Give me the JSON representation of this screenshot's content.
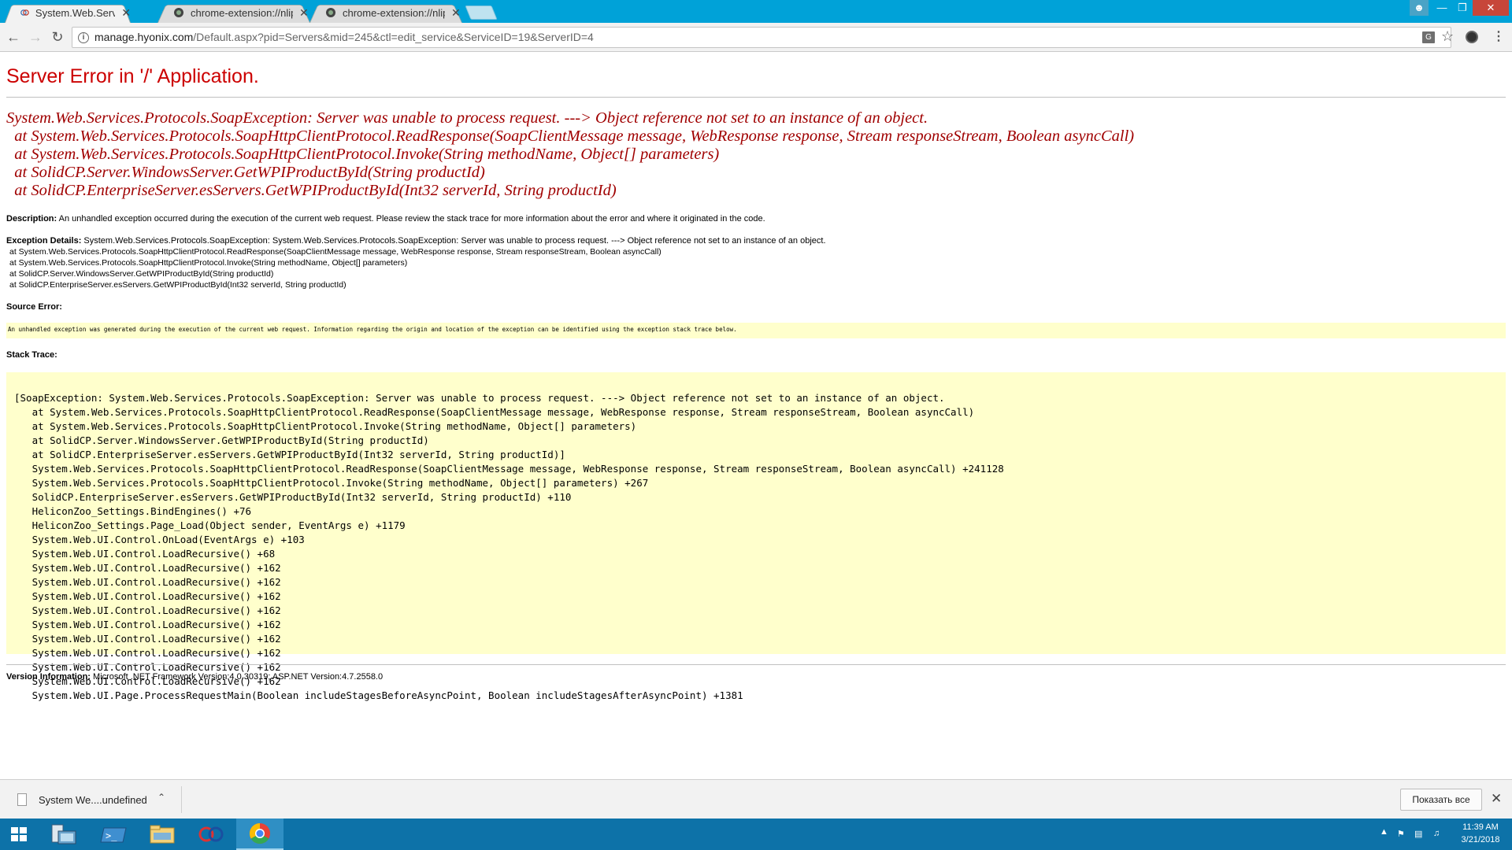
{
  "browser": {
    "tabs": [
      {
        "title": "System.Web.Services.Pro",
        "active": true
      },
      {
        "title": "chrome-extension://nlip",
        "active": false
      },
      {
        "title": "chrome-extension://nlip",
        "active": false
      }
    ],
    "url_host": "manage.hyonix.com",
    "url_path": "/Default.aspx?pid=Servers&mid=245&ctl=edit_service&ServiceID=19&ServerID=4"
  },
  "page": {
    "title": "Server Error in '/' Application.",
    "main_error": "System.Web.Services.Protocols.SoapException: Server was unable to process request. ---> Object reference not set to an instance of an object.\n  at System.Web.Services.Protocols.SoapHttpClientProtocol.ReadResponse(SoapClientMessage message, WebResponse response, Stream responseStream, Boolean asyncCall)\n  at System.Web.Services.Protocols.SoapHttpClientProtocol.Invoke(String methodName, Object[] parameters)\n  at SolidCP.Server.WindowsServer.GetWPIProductById(String productId)\n  at SolidCP.EnterpriseServer.esServers.GetWPIProductById(Int32 serverId, String productId)",
    "description_label": "Description:",
    "description_text": " An unhandled exception occurred during the execution of the current web request. Please review the stack trace for more information about the error and where it originated in the code.",
    "exception_label": "Exception Details:",
    "exception_text": " System.Web.Services.Protocols.SoapException: System.Web.Services.Protocols.SoapException: Server was unable to process request. ---> Object reference not set to an instance of an object.",
    "exception_lines": "at System.Web.Services.Protocols.SoapHttpClientProtocol.ReadResponse(SoapClientMessage message, WebResponse response, Stream responseStream, Boolean asyncCall)\nat System.Web.Services.Protocols.SoapHttpClientProtocol.Invoke(String methodName, Object[] parameters)\nat SolidCP.Server.WindowsServer.GetWPIProductById(String productId)\nat SolidCP.EnterpriseServer.esServers.GetWPIProductById(Int32 serverId, String productId)",
    "source_label": "Source Error:",
    "source_text": "An unhandled exception was generated during the execution of the current web request. Information regarding the origin and location of the exception can be identified using the exception stack trace below.",
    "stack_label": "Stack Trace:",
    "stack_text": "[SoapException: System.Web.Services.Protocols.SoapException: Server was unable to process request. ---> Object reference not set to an instance of an object.\n   at System.Web.Services.Protocols.SoapHttpClientProtocol.ReadResponse(SoapClientMessage message, WebResponse response, Stream responseStream, Boolean asyncCall)\n   at System.Web.Services.Protocols.SoapHttpClientProtocol.Invoke(String methodName, Object[] parameters)\n   at SolidCP.Server.WindowsServer.GetWPIProductById(String productId)\n   at SolidCP.EnterpriseServer.esServers.GetWPIProductById(Int32 serverId, String productId)]\n   System.Web.Services.Protocols.SoapHttpClientProtocol.ReadResponse(SoapClientMessage message, WebResponse response, Stream responseStream, Boolean asyncCall) +241128\n   System.Web.Services.Protocols.SoapHttpClientProtocol.Invoke(String methodName, Object[] parameters) +267\n   SolidCP.EnterpriseServer.esServers.GetWPIProductById(Int32 serverId, String productId) +110\n   HeliconZoo_Settings.BindEngines() +76\n   HeliconZoo_Settings.Page_Load(Object sender, EventArgs e) +1179\n   System.Web.UI.Control.OnLoad(EventArgs e) +103\n   System.Web.UI.Control.LoadRecursive() +68\n   System.Web.UI.Control.LoadRecursive() +162\n   System.Web.UI.Control.LoadRecursive() +162\n   System.Web.UI.Control.LoadRecursive() +162\n   System.Web.UI.Control.LoadRecursive() +162\n   System.Web.UI.Control.LoadRecursive() +162\n   System.Web.UI.Control.LoadRecursive() +162\n   System.Web.UI.Control.LoadRecursive() +162\n   System.Web.UI.Control.LoadRecursive() +162\n   System.Web.UI.Control.LoadRecursive() +162\n   System.Web.UI.Page.ProcessRequestMain(Boolean includeStagesBeforeAsyncPoint, Boolean includeStagesAfterAsyncPoint) +1381",
    "version_label": "Version Information:",
    "version_text": " Microsoft .NET Framework Version:4.0.30319; ASP.NET Version:4.7.2558.0"
  },
  "download_shelf": {
    "file_name": "System We....undefined",
    "show_all_label": "Показать все"
  },
  "taskbar": {
    "time": "11:39 AM",
    "date": "3/21/2018"
  },
  "colors": {
    "title_red": "#cc0000",
    "error_red": "#a00000",
    "code_bg": "#ffffcc",
    "tab_strip": "#00a2d8",
    "taskbar": "#0d72a8"
  },
  "icons": [
    "back-arrow-icon",
    "forward-arrow-icon",
    "reload-icon",
    "info-icon",
    "translate-icon",
    "star-icon",
    "extension-icon",
    "menu-icon",
    "file-icon",
    "chevron-up-icon",
    "close-icon",
    "windows-logo-icon",
    "server-manager-icon",
    "powershell-icon",
    "file-explorer-icon",
    "solidcp-icon",
    "chrome-icon",
    "tray-flag-icon",
    "tray-network-icon",
    "tray-volume-icon"
  ]
}
